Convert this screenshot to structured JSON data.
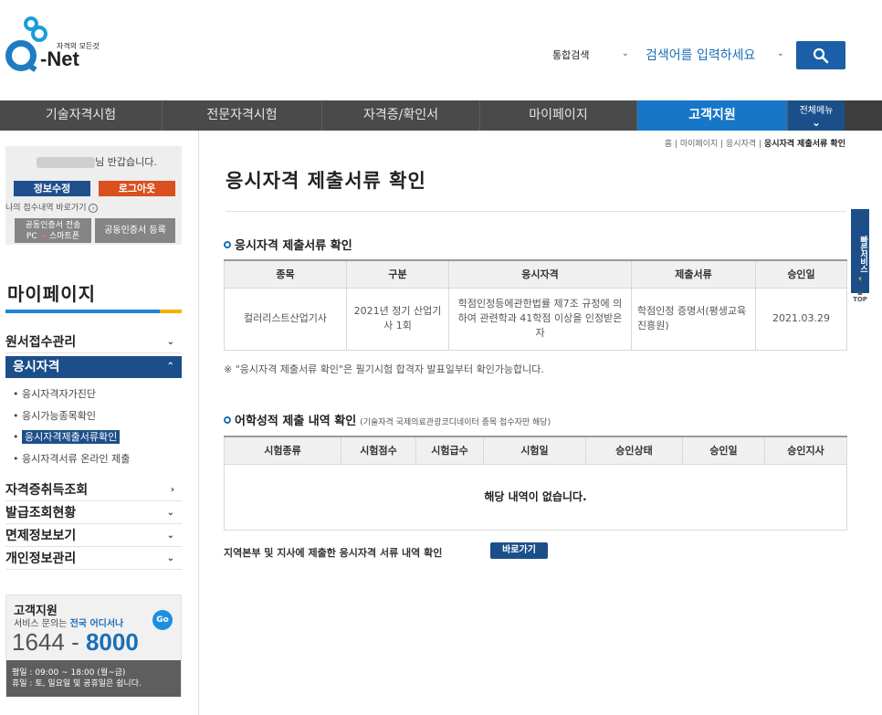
{
  "header": {
    "logo_small": "자격의 모든것",
    "logo_main": "-Net",
    "search_scope": "통합검색",
    "search_placeholder": "검색어를 입력하세요"
  },
  "nav": {
    "items": [
      "기술자격시험",
      "전문자격시험",
      "자격증/확인서",
      "마이페이지",
      "고객지원"
    ],
    "all_menu": "전체메뉴"
  },
  "sidebar": {
    "greeting_suffix": "님 반갑습니다.",
    "edit_button": "정보수정",
    "logout_button": "로그아웃",
    "recent_link": "나의 접수내역 바로가기",
    "cert_transfer_line1": "공동인증서 전송",
    "cert_transfer_pc": "PC",
    "cert_transfer_smart": "스마트폰",
    "cert_register": "공동인증서 등록",
    "section_title": "마이페이지",
    "menus": {
      "application": "원서접수관리",
      "qualification": "응시자격",
      "cert_lookup": "자격증취득조회",
      "issue_status": "발급조회현황",
      "exemption": "면제정보보기",
      "privacy": "개인정보관리"
    },
    "submenus": [
      "응시자격자가진단",
      "응시가능종목확인",
      "응시자격제출서류확인",
      "응시자격서류 온라인 제출"
    ],
    "cs": {
      "title": "고객지원",
      "desc_prefix": "서비스 문의는 ",
      "desc_bold": "전국 어디서나",
      "go": "Go",
      "num_a": "1644 - ",
      "num_b": "8000",
      "hours1": "평일 : 09:00 ~ 18:00 (월~금)",
      "hours2": "휴일 : 토, 일요일 및 공휴일은 쉽니다."
    }
  },
  "breadcrumb": {
    "home": "홈",
    "sep": " | ",
    "mypage": "마이페이지",
    "qual": "응시자격",
    "current": "응시자격 제출서류 확인"
  },
  "main": {
    "title": "응시자격 제출서류 확인",
    "section1": "응시자격 제출서류 확인",
    "table1": {
      "headers": [
        "종목",
        "구분",
        "응시자격",
        "제출서류",
        "승인일"
      ],
      "row": [
        "컬러리스트산업기사",
        "2021년 정기 산업기사 1회",
        "학점인정등에관한법률 제7조 규정에 의하여 관련학과 41학점 이상을 인정받은 자",
        "학점인정 증명서(평생교육진흥원)",
        "2021.03.29"
      ]
    },
    "notice": "※ \"응시자격 제출서류 확인\"은 필기시험 합격자 발표일부터 확인가능합니다.",
    "section2": "어학성적 제출 내역 확인",
    "section2_note": "(기술자격 국제의료관광코디네이터 종목 접수자만 해당)",
    "table2": {
      "headers": [
        "시험종류",
        "시험점수",
        "시험급수",
        "시험일",
        "승인상태",
        "승인일",
        "승인지사"
      ],
      "empty": "해당 내역이 없습니다."
    },
    "bottom_text": "지역본부 및 지사에 제출한 응시자격 서류 내역 확인",
    "goto_button": "바로가기"
  },
  "quick": {
    "label": "빠른서비스",
    "top": "TOP"
  }
}
